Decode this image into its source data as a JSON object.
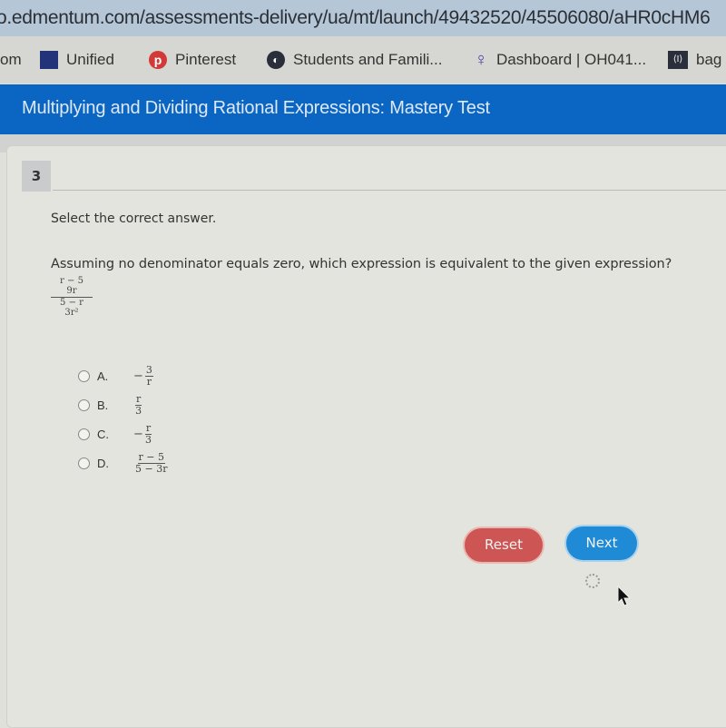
{
  "browser": {
    "url": "o.edmentum.com/assessments-delivery/ua/mt/launch/49432520/45506080/aHR0cHM6",
    "bookmarks": [
      {
        "label": "om",
        "icon": "none"
      },
      {
        "label": "Unified",
        "icon": "unified-icon"
      },
      {
        "label": "Pinterest",
        "icon": "pinterest-icon"
      },
      {
        "label": "Students and Famili...",
        "icon": "globe-icon"
      },
      {
        "label": "Dashboard | OH041...",
        "icon": "lightbulb-icon"
      },
      {
        "label": "bag",
        "icon": "bag-icon"
      }
    ]
  },
  "header": {
    "title": "Multiplying and Dividing Rational Expressions: Mastery Test",
    "color": "#0a66c2"
  },
  "question": {
    "number": "3",
    "instruction": "Select the correct answer.",
    "prompt": "Assuming no denominator equals zero, which expression is equivalent to the given expression?",
    "given_expression": {
      "top_numerator": "r − 5",
      "top_denominator": "9r",
      "bottom_numerator": "5 − r",
      "bottom_denominator": "3r²"
    },
    "options": [
      {
        "letter": "A.",
        "sign": "−",
        "numerator": "3",
        "denominator": "r"
      },
      {
        "letter": "B.",
        "sign": "",
        "numerator": "r",
        "denominator": "3"
      },
      {
        "letter": "C.",
        "sign": "−",
        "numerator": "r",
        "denominator": "3"
      },
      {
        "letter": "D.",
        "sign": "",
        "numerator": "r − 5",
        "denominator": "5 − 3r"
      }
    ]
  },
  "buttons": {
    "reset": "Reset",
    "next": "Next",
    "reset_color": "#cd5654",
    "next_color": "#1f8ad6"
  }
}
